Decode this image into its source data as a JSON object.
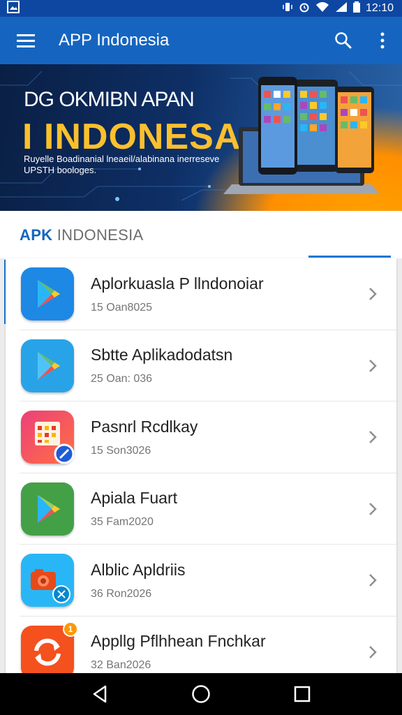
{
  "status": {
    "time": "12:10"
  },
  "appbar": {
    "title": "APP Indonesia"
  },
  "banner": {
    "line1": "DG OKMIBN APAN",
    "line2": "I INDONESA",
    "line3": "Ruyelle Boadinanial lneaeil/alabinana inerreseve UPSTH boologes."
  },
  "tab": {
    "label_strong": "APK",
    "label_rest": " INDONESIA"
  },
  "apps": [
    {
      "name": "Aplorkuasla P llndonoiar",
      "sub": "15 Oan8025",
      "icon": "play-store-icon",
      "color": "#1e88e5"
    },
    {
      "name": "Sbtte Aplikadodatsn",
      "sub": "25 Oan: 036",
      "icon": "play-store-icon",
      "color": "#29a3e8"
    },
    {
      "name": "Pasnrl Rcdlkay",
      "sub": "15 Son3026",
      "icon": "calendar-icon",
      "color": "#e91e63"
    },
    {
      "name": "Apiala Fuart",
      "sub": "35 Fam2020",
      "icon": "play-store-icon",
      "color": "#43a047"
    },
    {
      "name": "Alblic Apldriis",
      "sub": "36 Ron2026",
      "icon": "camera-icon",
      "color": "#29b6f6"
    },
    {
      "name": "Appllg Pflhhean Fnchkar",
      "sub": "32 Ban2026",
      "icon": "sync-icon",
      "color": "#f4511e",
      "badge": "1"
    }
  ]
}
